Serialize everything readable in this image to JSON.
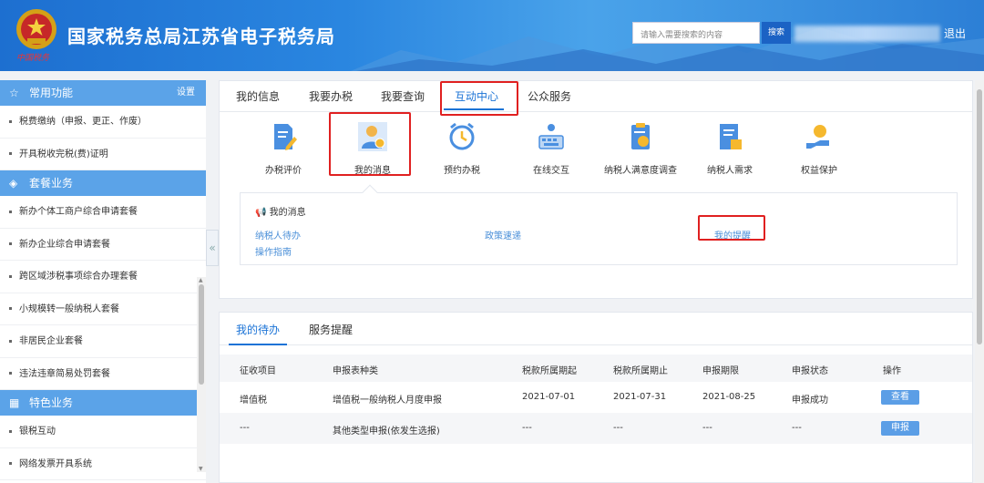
{
  "header": {
    "title": "国家税务总局江苏省电子税务局",
    "logo_sub": "中国税务",
    "search_placeholder": "请输入需要搜索的内容",
    "search_button": "搜索",
    "logout": "退出"
  },
  "sidebar": {
    "sections": [
      {
        "title": "常用功能",
        "action": "设置",
        "icon": "star-icon",
        "items": [
          "税费缴纳（申报、更正、作废）",
          "开具税收完税(费)证明"
        ]
      },
      {
        "title": "套餐业务",
        "icon": "layers-icon",
        "items": [
          "新办个体工商户综合申请套餐",
          "新办企业综合申请套餐",
          "跨区域涉税事项综合办理套餐",
          "小规模转一般纳税人套餐",
          "非居民企业套餐",
          "违法违章简易处罚套餐"
        ]
      },
      {
        "title": "特色业务",
        "icon": "grid-icon",
        "items": [
          "银税互动",
          "网络发票开具系统"
        ]
      }
    ]
  },
  "top_tabs": [
    "我的信息",
    "我要办税",
    "我要查询",
    "互动中心",
    "公众服务"
  ],
  "active_tab": "互动中心",
  "interactive_icons": [
    {
      "label": "办税评价",
      "icon": "evaluation-doc-icon"
    },
    {
      "label": "我的消息",
      "icon": "message-person-icon"
    },
    {
      "label": "预约办税",
      "icon": "alarm-clock-icon"
    },
    {
      "label": "在线交互",
      "icon": "online-keyboard-icon"
    },
    {
      "label": "纳税人满意度调查",
      "icon": "survey-clipboard-icon"
    },
    {
      "label": "纳税人需求",
      "icon": "request-doc-icon"
    },
    {
      "label": "权益保护",
      "icon": "hand-protect-icon"
    }
  ],
  "message_panel": {
    "title": "我的消息",
    "links": [
      "纳税人待办",
      "政策速递",
      "我的提醒",
      "操作指南"
    ]
  },
  "bottom_tabs": [
    "我的待办",
    "服务提醒"
  ],
  "table": {
    "headers": [
      "征收项目",
      "申报表种类",
      "税款所属期起",
      "税款所属期止",
      "申报期限",
      "申报状态",
      "操作"
    ],
    "rows": [
      [
        "增值税",
        "增值税一般纳税人月度申报",
        "2021-07-01",
        "2021-07-31",
        "2021-08-25",
        "申报成功",
        "查看"
      ],
      [
        "---",
        "其他类型申报(依发生选报)",
        "---",
        "---",
        "---",
        "---",
        "申报"
      ]
    ]
  },
  "colors": {
    "header_blue": "#2a86e0",
    "accent": "#1b73d6",
    "highlight_red": "#e02020"
  }
}
